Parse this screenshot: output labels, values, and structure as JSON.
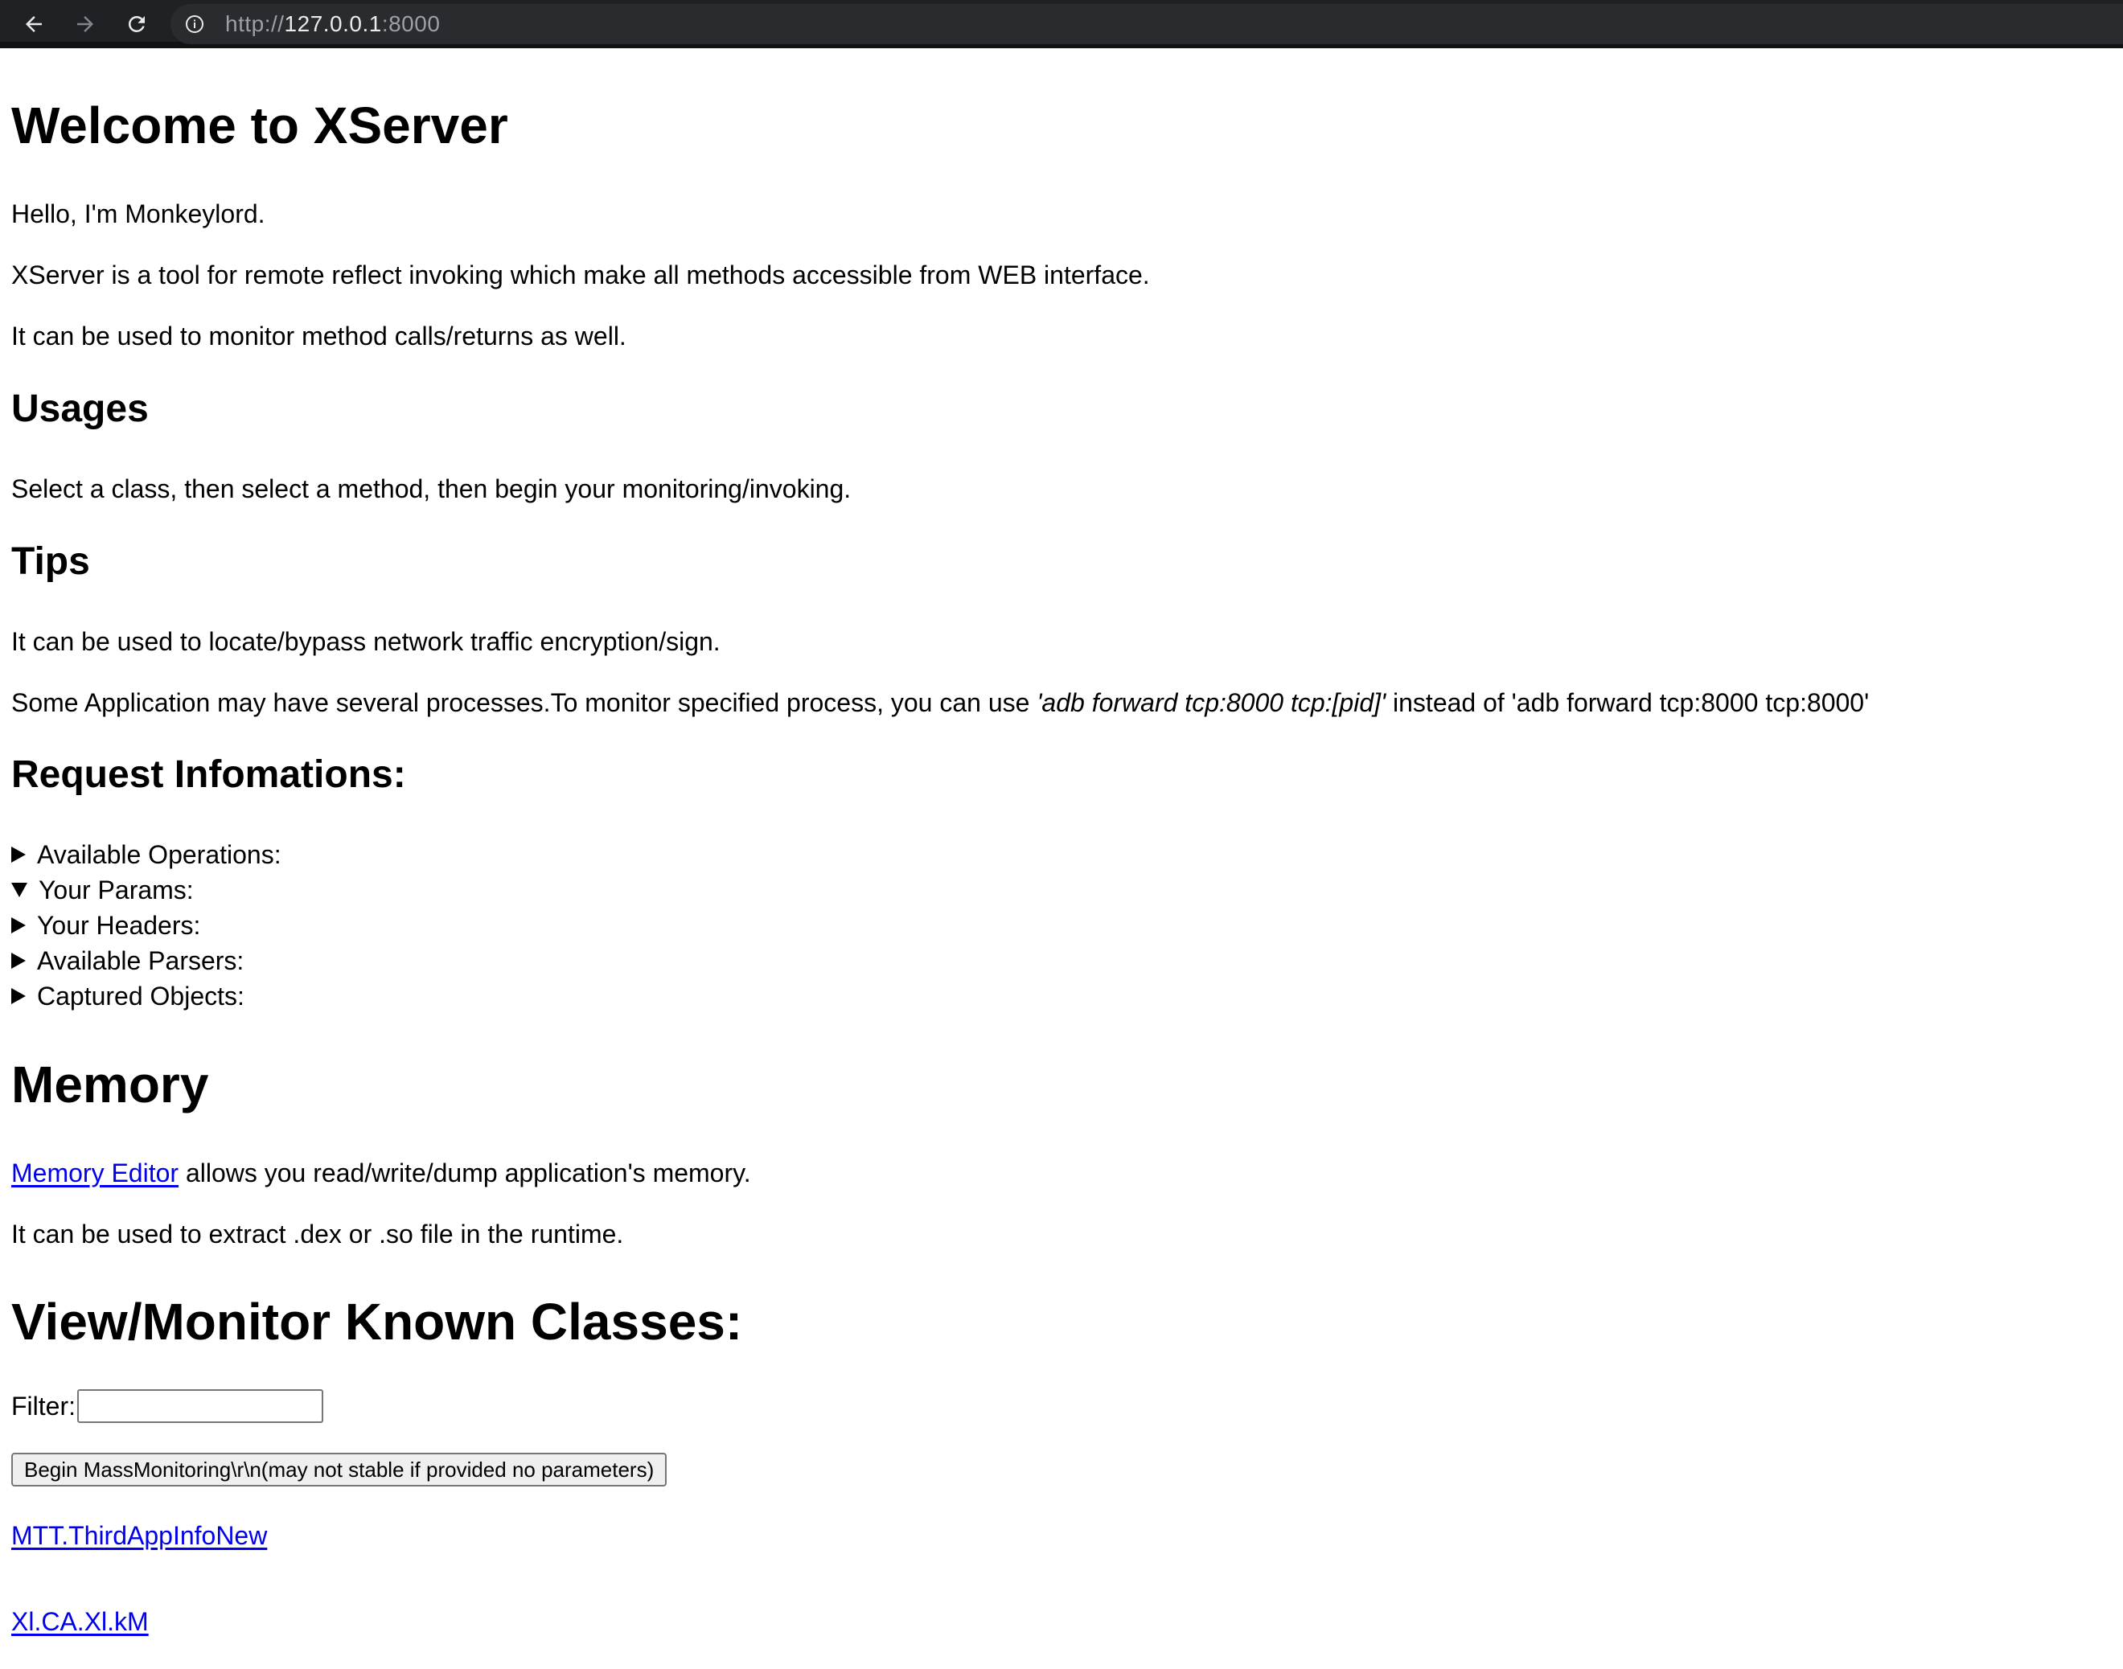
{
  "browser": {
    "url_scheme": "http://",
    "url_host": "127.0.0.1",
    "url_port": ":8000",
    "icons": [
      "back-arrow-icon",
      "forward-arrow-icon",
      "reload-icon",
      "info-icon"
    ]
  },
  "page": {
    "title": "Welcome to XServer",
    "intro": [
      "Hello, I'm Monkeylord.",
      "XServer is a tool for remote reflect invoking which make all methods accessible from WEB interface.",
      "It can be used to monitor method calls/returns as well."
    ],
    "usages": {
      "heading": "Usages",
      "text": "Select a class, then select a method, then begin your monitoring/invoking."
    },
    "tips": {
      "heading": "Tips",
      "line1": "It can be used to locate/bypass network traffic encryption/sign.",
      "line2_prefix": "Some Application may have several processes.To monitor specified process, you can use ",
      "line2_em": "'adb forward tcp:8000 tcp:[pid]'",
      "line2_suffix": " instead of 'adb forward tcp:8000 tcp:8000'"
    },
    "request": {
      "heading": "Request Infomations:",
      "details": [
        {
          "label": "Available Operations:",
          "open": false
        },
        {
          "label": "Your Params:",
          "open": true
        },
        {
          "label": "Your Headers:",
          "open": false
        },
        {
          "label": "Available Parsers:",
          "open": false
        },
        {
          "label": "Captured Objects:",
          "open": false
        }
      ]
    },
    "memory": {
      "heading": "Memory",
      "link": "Memory Editor",
      "line1_suffix": " allows you read/write/dump application's memory.",
      "line2": "It can be used to extract .dex or .so file in the runtime."
    },
    "classes": {
      "heading": "View/Monitor Known Classes:",
      "filter_label": "Filter:",
      "filter_value": "",
      "mass_button": "Begin MassMonitoring\\r\\n(may not stable if provided no parameters)",
      "links": [
        "MTT.ThirdAppInfoNew",
        "Xl.CA.Xl.kM"
      ]
    }
  },
  "colors": {
    "toolbar": "#202124",
    "link": "#0000ee"
  }
}
